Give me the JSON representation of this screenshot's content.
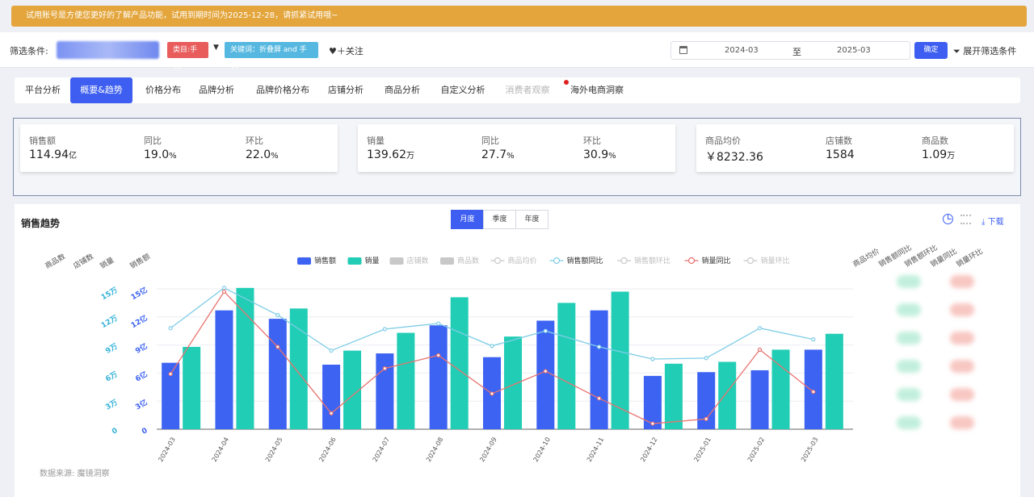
{
  "banner": {
    "text": "试用账号是方便您更好的了解产品功能，试用到期时间为2025-12-28，请抓紧试用哦~"
  },
  "filter": {
    "label": "筛选条件:",
    "category_tag": "类目:手机",
    "keyword_tag": "关键词：折叠屏 and 手机",
    "follow": "♥＋关注",
    "date_start": "2024-03",
    "date_to": "至",
    "date_end": "2025-03",
    "confirm": "确定",
    "expand": "展开筛选条件"
  },
  "tabs": [
    {
      "label": "平台分析"
    },
    {
      "label": "概要&趋势",
      "active": true
    },
    {
      "label": "价格分布"
    },
    {
      "label": "品牌分析"
    },
    {
      "label": "品牌价格分布"
    },
    {
      "label": "店铺分析"
    },
    {
      "label": "商品分析"
    },
    {
      "label": "自定义分析"
    },
    {
      "label": "消费者观察",
      "dim": true
    },
    {
      "label": "海外电商洞察"
    }
  ],
  "kpi_cards": [
    [
      {
        "label": "销售额",
        "value": "114.94",
        "unit": "亿"
      },
      {
        "label": "同比",
        "value": "19.0",
        "unit": "%"
      },
      {
        "label": "环比",
        "value": "22.0",
        "unit": "%"
      }
    ],
    [
      {
        "label": "销量",
        "value": "139.62",
        "unit": "万"
      },
      {
        "label": "同比",
        "value": "27.7",
        "unit": "%"
      },
      {
        "label": "环比",
        "value": "30.9",
        "unit": "%"
      }
    ],
    [
      {
        "label": "商品均价",
        "value": "￥8232.36",
        "unit": ""
      },
      {
        "label": "店铺数",
        "value": "1584",
        "unit": ""
      },
      {
        "label": "商品数",
        "value": "1.09",
        "unit": "万"
      }
    ]
  ],
  "chart_panel": {
    "title": "销售趋势",
    "segments": [
      {
        "label": "月度",
        "active": true
      },
      {
        "label": "季度"
      },
      {
        "label": "年度"
      }
    ],
    "download": "下载",
    "source": "数据来源: 魔镜洞察"
  },
  "colors": {
    "sales": "#3d63f2",
    "volume": "#22cdb5",
    "sales_yoy": "#7ecde6",
    "volume_yoy": "#e8726e",
    "accent": "#3d5ef0",
    "banner": "#e3a53c"
  },
  "chart_data": {
    "type": "bar",
    "categories": [
      "2024-03",
      "2024-04",
      "2024-05",
      "2024-06",
      "2024-07",
      "2024-08",
      "2024-09",
      "2024-10",
      "2024-11",
      "2024-12",
      "2025-01",
      "2025-02",
      "2025-03"
    ],
    "legend": [
      {
        "name": "销售额",
        "kind": "bar",
        "color": "#3d63f2",
        "on": true
      },
      {
        "name": "销量",
        "kind": "bar",
        "color": "#22cdb5",
        "on": true
      },
      {
        "name": "店铺数",
        "kind": "bar",
        "color": "#c8c8c8",
        "on": false
      },
      {
        "name": "商品数",
        "kind": "bar",
        "color": "#c8c8c8",
        "on": false
      },
      {
        "name": "商品均价",
        "kind": "line",
        "color": "#c8c8c8",
        "on": false
      },
      {
        "name": "销售额同比",
        "kind": "line",
        "color": "#7ecde6",
        "on": true
      },
      {
        "name": "销售额环比",
        "kind": "line",
        "color": "#c8c8c8",
        "on": false
      },
      {
        "name": "销量同比",
        "kind": "line",
        "color": "#e8726e",
        "on": true
      },
      {
        "name": "销量环比",
        "kind": "line",
        "color": "#c8c8c8",
        "on": false
      }
    ],
    "left_axes": [
      {
        "name": "商品数",
        "ticks": []
      },
      {
        "name": "店铺数",
        "ticks": []
      },
      {
        "name": "销量",
        "ticks": [
          "0",
          "3万",
          "6万",
          "9万",
          "12万",
          "15万"
        ]
      },
      {
        "name": "销售额",
        "ticks": [
          "0",
          "3亿",
          "6亿",
          "9亿",
          "12亿",
          "15亿"
        ]
      }
    ],
    "right_axes": [
      "商品均价",
      "销售额同比",
      "销售额环比",
      "销量同比",
      "销量环比"
    ],
    "ylim": [
      0,
      15
    ],
    "series": [
      {
        "name": "销售额",
        "unit": "亿",
        "values": [
          7.1,
          12.7,
          11.8,
          6.9,
          8.1,
          11.1,
          7.7,
          11.6,
          12.7,
          5.7,
          6.1,
          6.3,
          8.5
        ]
      },
      {
        "name": "销量",
        "unit": "万",
        "values": [
          8.8,
          15.1,
          12.9,
          8.4,
          10.3,
          14.1,
          9.9,
          13.5,
          14.7,
          7.0,
          7.2,
          8.5,
          10.2
        ]
      },
      {
        "name": "销售额同比",
        "values": [
          10.8,
          15.1,
          12.2,
          8.4,
          10.7,
          11.3,
          8.9,
          10.5,
          8.8,
          7.5,
          7.6,
          10.8,
          9.6
        ]
      },
      {
        "name": "销量同比",
        "values": [
          5.9,
          14.7,
          8.8,
          1.7,
          6.5,
          7.9,
          3.8,
          6.2,
          3.3,
          0.6,
          1.1,
          8.5,
          4.0
        ]
      }
    ]
  }
}
